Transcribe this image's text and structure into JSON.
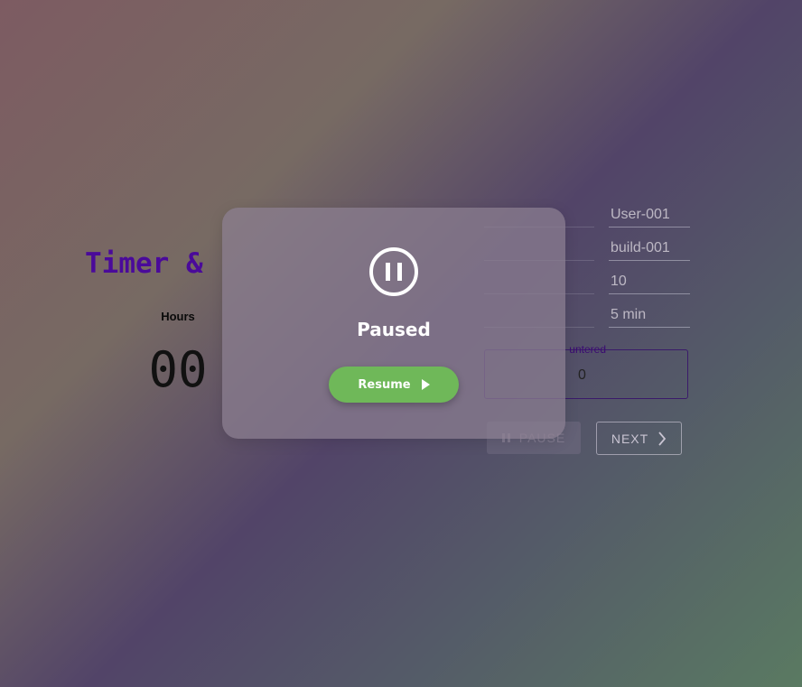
{
  "app": {
    "title": "Timer &",
    "timer": {
      "hours_label": "Hours",
      "hours_value": "00"
    },
    "fields": [
      {
        "value": "User-001"
      },
      {
        "value": "build-001"
      },
      {
        "value": "10"
      },
      {
        "value": "5 min"
      }
    ],
    "bugs": {
      "label": "untered",
      "value": "0"
    },
    "buttons": {
      "pause": "PAUSE",
      "next": "NEXT"
    }
  },
  "overlay": {
    "status": "Paused",
    "resume_label": "Resume",
    "pause_icon": "pause-circle-icon",
    "play_icon": "play-icon"
  }
}
